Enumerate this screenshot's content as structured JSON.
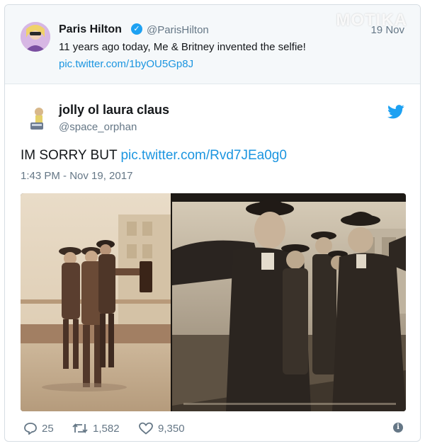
{
  "watermark": "MOTIKA",
  "quoted_tweet": {
    "name": "Paris Hilton",
    "handle": "@ParisHilton",
    "date": "19 Nov",
    "text": "11 years ago today, Me & Britney invented the selfie!",
    "link": "pic.twitter.com/1byOU5Gp8J"
  },
  "tweet": {
    "name": "jolly ol laura claus",
    "handle": "@space_orphan",
    "text_prefix": "IM SORRY BUT",
    "link": "pic.twitter.com/Rvd7JEa0g0",
    "timestamp": "1:43 PM - Nov 19, 2017",
    "replies": "25",
    "retweets": "1,582",
    "likes": "9,350"
  },
  "icons": {
    "verified": "verified-badge-icon",
    "bird": "twitter-bird-icon",
    "reply": "reply-icon",
    "retweet": "retweet-icon",
    "like": "heart-icon",
    "info": "info-icon"
  },
  "colors": {
    "link": "#1b95e0",
    "verified": "#1da1f2",
    "muted": "#657786"
  }
}
